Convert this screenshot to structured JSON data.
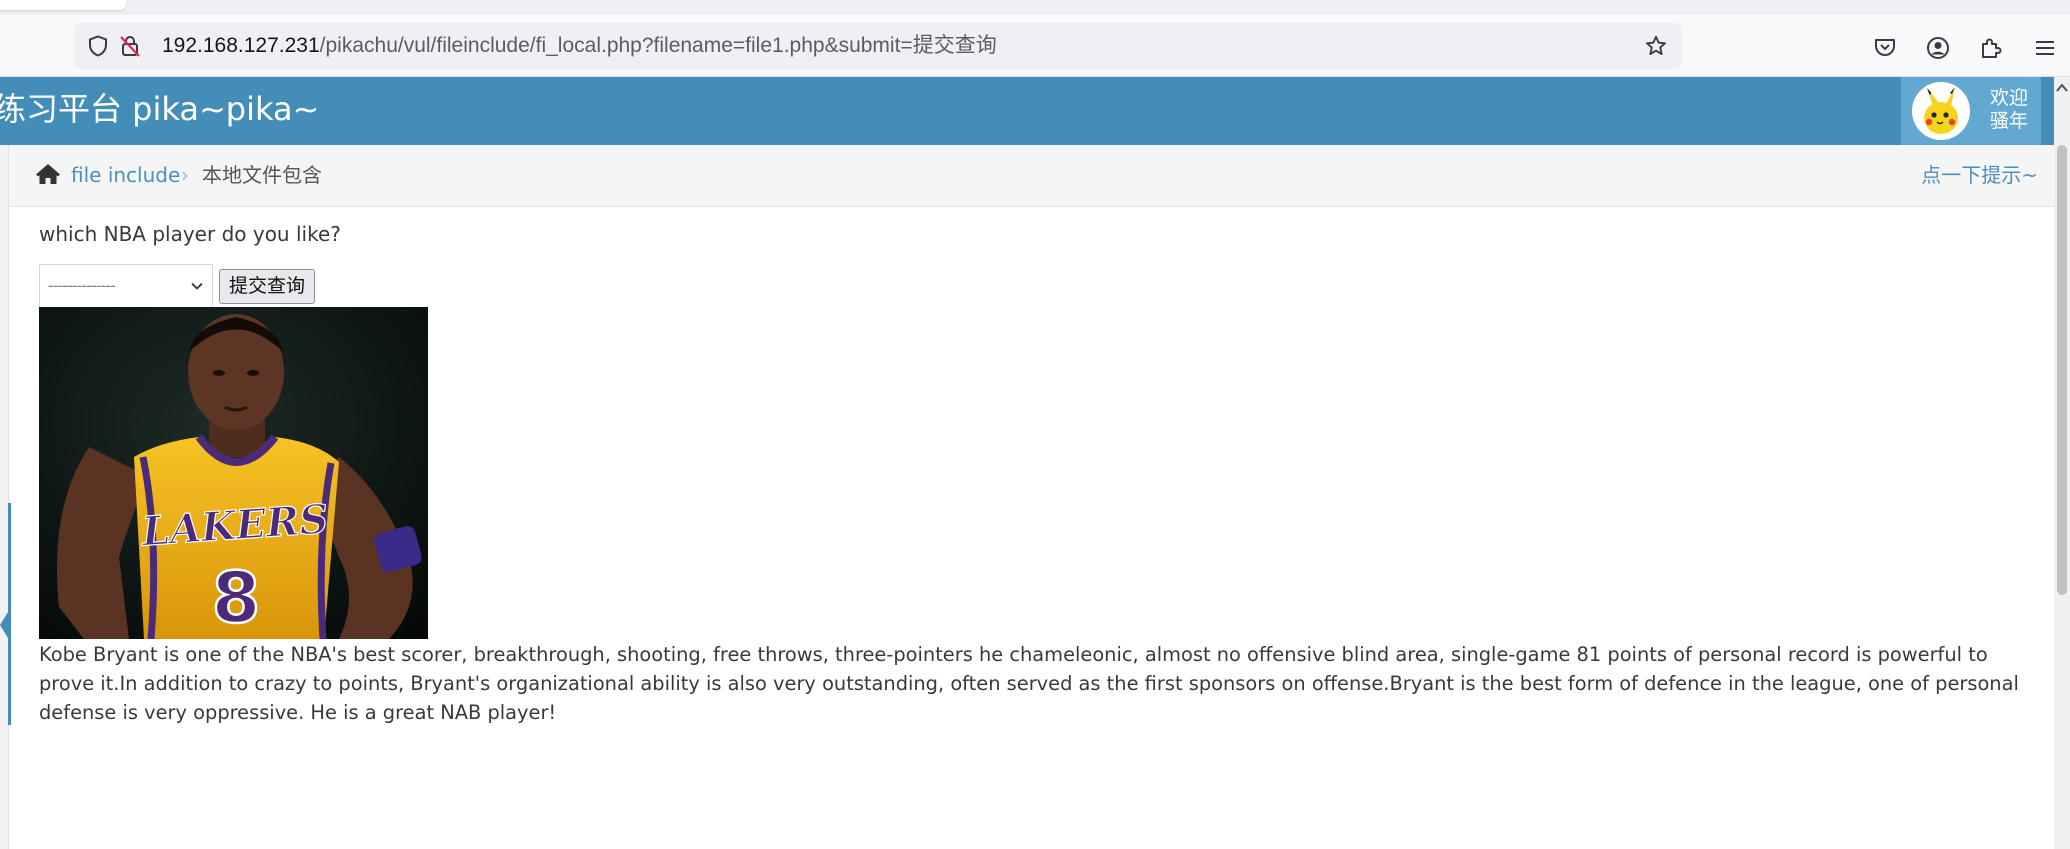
{
  "browser": {
    "url_host": "192.168.127.231",
    "url_path": "/pikachu/vul/fileinclude/fi_local.php?filename=file1.php&submit=提交查询"
  },
  "header": {
    "brand": "练习平台 pika~pika~",
    "welcome": "欢迎骚年"
  },
  "breadcrumbs": {
    "section": "file include",
    "separator": "›",
    "current": "本地文件包含",
    "hint": "点一下提示~"
  },
  "main": {
    "question": "which NBA player do you like?",
    "select_value": "--------------",
    "submit_label": "提交查询",
    "description": "Kobe Bryant is one of the NBA's best scorer, breakthrough, shooting, free throws, three-pointers he chameleonic, almost no offensive blind area, single-game 81 points of personal record is powerful to prove it.In addition to crazy to points, Bryant's organizational ability is also very outstanding, often served as the first sponsors on offense.Bryant is the best form of defence in the league, one of personal defense is very oppressive. He is a great NAB player!"
  },
  "icons": {
    "shield": "shield-icon",
    "insecure": "insecure-lock-icon",
    "bookmark": "star-icon",
    "pocket": "pocket-icon",
    "account": "account-icon",
    "extensions": "extensions-icon",
    "menu": "hamburger-menu-icon",
    "home": "home-icon",
    "dropdown": "chevron-down-icon"
  },
  "colors": {
    "header_bg": "#438eb9",
    "user_box_bg": "#62a8d1",
    "link": "#4c8fbd",
    "jersey_gold": "#f2b10e",
    "jersey_purple": "#4b2a7a"
  }
}
